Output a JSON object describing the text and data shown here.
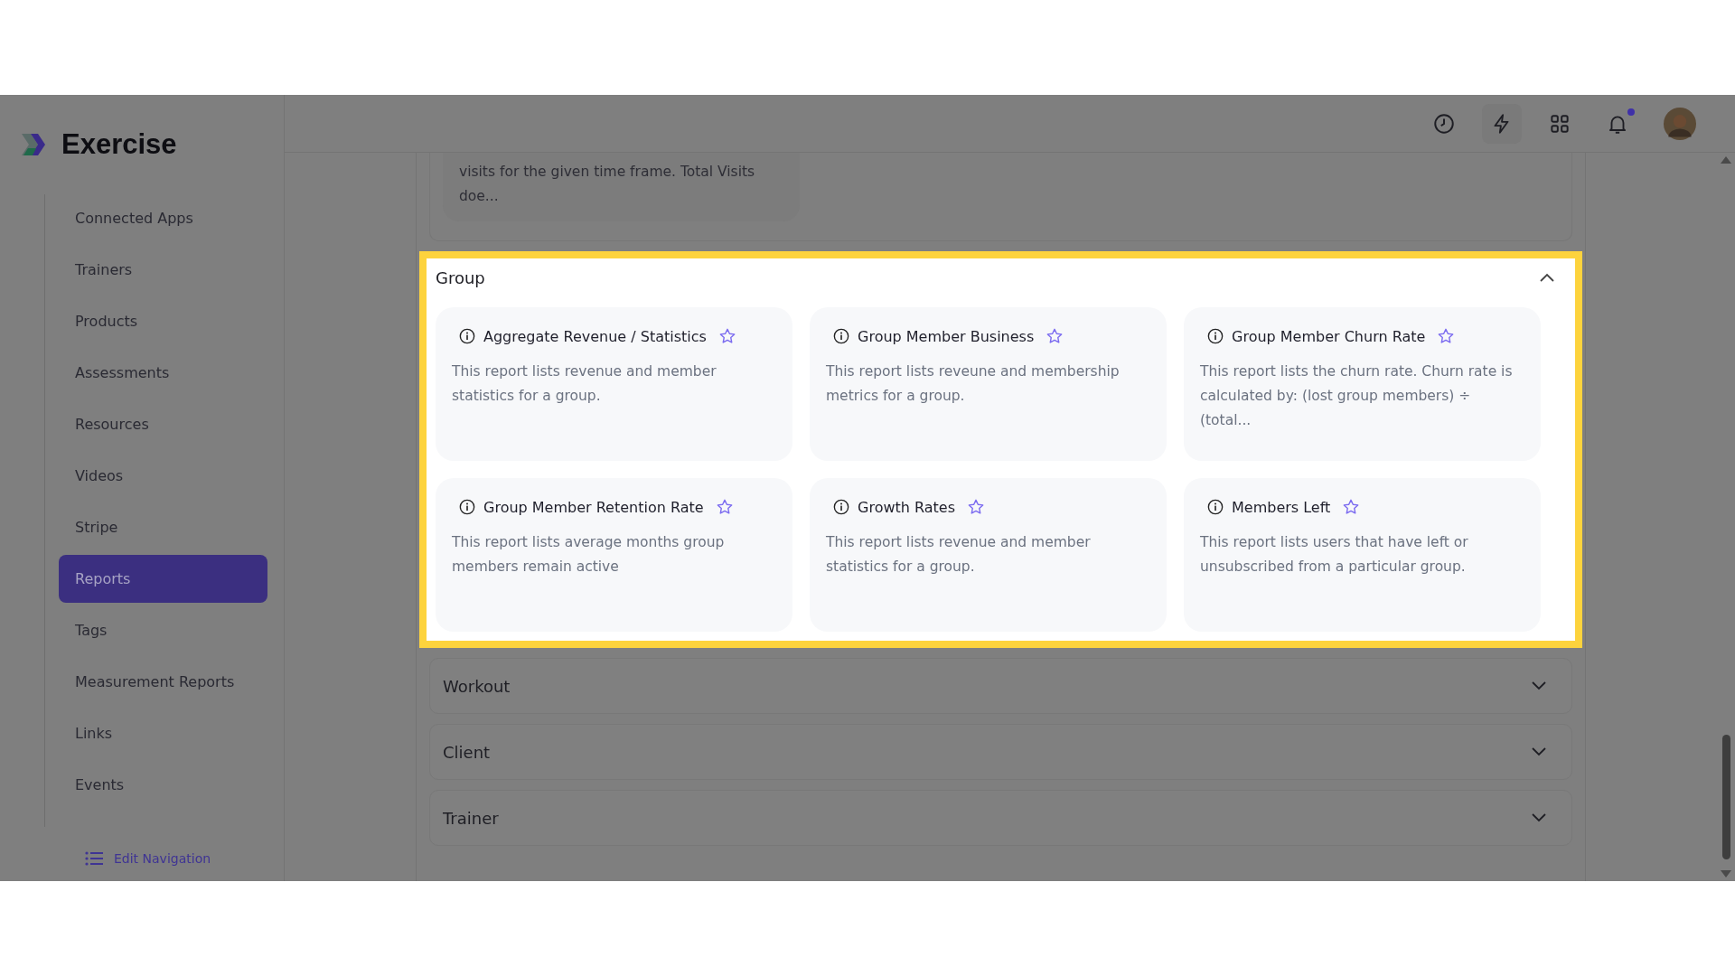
{
  "app": {
    "name": "Exercise"
  },
  "sidebar": {
    "items": [
      {
        "label": "Connected Apps",
        "selected": false
      },
      {
        "label": "Trainers",
        "selected": false
      },
      {
        "label": "Products",
        "selected": false
      },
      {
        "label": "Assessments",
        "selected": false
      },
      {
        "label": "Resources",
        "selected": false
      },
      {
        "label": "Videos",
        "selected": false
      },
      {
        "label": "Stripe",
        "selected": false
      },
      {
        "label": "Reports",
        "selected": true
      },
      {
        "label": "Tags",
        "selected": false
      },
      {
        "label": "Measurement Reports",
        "selected": false
      },
      {
        "label": "Links",
        "selected": false
      },
      {
        "label": "Events",
        "selected": false
      }
    ],
    "edit_navigation": "Edit Navigation"
  },
  "header": {
    "notification_unread": true
  },
  "partial_card": {
    "description": "visits for the given time frame. Total Visits doe..."
  },
  "sections": [
    {
      "title": "Group",
      "expanded": true,
      "highlighted": true,
      "reports": [
        {
          "title": "Aggregate Revenue / Statistics",
          "favorite": false,
          "description": "This report lists revenue and member statistics for a group."
        },
        {
          "title": "Group Member Business",
          "favorite": false,
          "description": "This report lists reveune and membership metrics for a group."
        },
        {
          "title": "Group Member Churn Rate",
          "favorite": false,
          "description": "This report lists the churn rate. Churn rate is calculated by: (lost group members) ÷ (total..."
        },
        {
          "title": "Group Member Retention Rate",
          "favorite": false,
          "description": "This report lists average months group members remain active"
        },
        {
          "title": "Growth Rates",
          "favorite": false,
          "description": "This report lists revenue and member statistics for a group."
        },
        {
          "title": "Members Left",
          "favorite": false,
          "description": "This report lists users that have left or unsubscribed from a particular group."
        }
      ]
    },
    {
      "title": "Workout",
      "expanded": false,
      "highlighted": false
    },
    {
      "title": "Client",
      "expanded": false,
      "highlighted": false
    },
    {
      "title": "Trainer",
      "expanded": false,
      "highlighted": false
    }
  ]
}
